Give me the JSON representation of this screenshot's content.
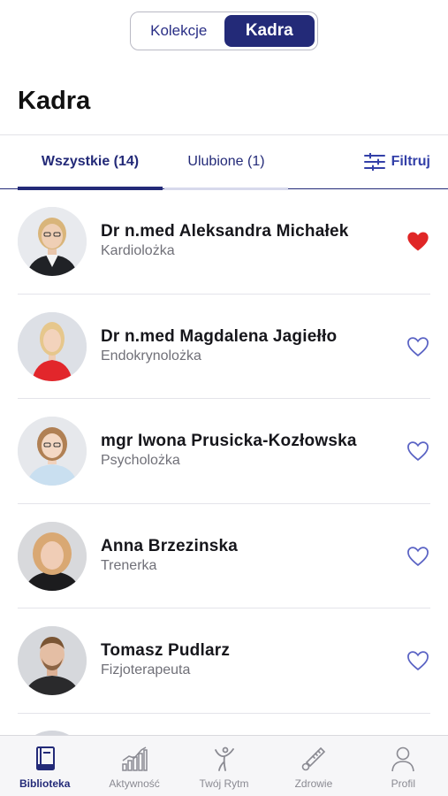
{
  "segment": {
    "left_label": "Kolekcje",
    "right_label": "Kadra",
    "selected": "Kadra"
  },
  "page": {
    "title": "Kadra"
  },
  "tabs": {
    "all_label": "Wszystkie (14)",
    "favorites_label": "Ulubione (1)",
    "filter_label": "Filtruj"
  },
  "staff": [
    {
      "name": "Dr n.med Aleksandra Michałek",
      "role": "Kardiolożka",
      "favorite": true,
      "icon": "heart-filled-icon"
    },
    {
      "name": "Dr n.med Magdalena Jagiełło",
      "role": "Endokrynolożka",
      "favorite": false,
      "icon": "heart-outline-icon"
    },
    {
      "name": "mgr Iwona Prusicka-Kozłowska",
      "role": "Psycholożka",
      "favorite": false,
      "icon": "heart-outline-icon"
    },
    {
      "name": "Anna Brzezinska",
      "role": "Trenerka",
      "favorite": false,
      "icon": "heart-outline-icon"
    },
    {
      "name": "Tomasz Pudlarz",
      "role": "Fizjoterapeuta",
      "favorite": false,
      "icon": "heart-outline-icon"
    }
  ],
  "bottom_nav": [
    {
      "label": "Biblioteka",
      "icon": "book-icon",
      "active": true
    },
    {
      "label": "Aktywność",
      "icon": "activity-chart-icon",
      "active": false
    },
    {
      "label": "Twój Rytm",
      "icon": "rhythm-figure-icon",
      "active": false
    },
    {
      "label": "Zdrowie",
      "icon": "thermometer-icon",
      "active": false
    },
    {
      "label": "Profil",
      "icon": "person-icon",
      "active": false
    }
  ],
  "colors": {
    "accent": "#232a78",
    "link": "#3340a8",
    "heart_active": "#e02626",
    "heart_outline": "#5a63c4"
  }
}
